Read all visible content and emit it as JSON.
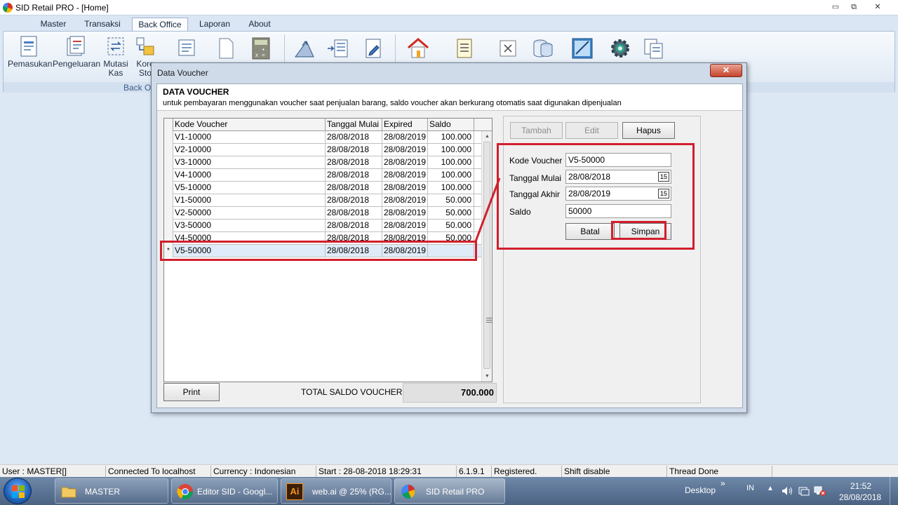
{
  "app": {
    "title": "SID Retail PRO - [Home]",
    "window_controls": {
      "minimize": "▭",
      "restore": "⧉",
      "close": "✕"
    }
  },
  "menu": {
    "tabs": [
      {
        "label": "Master"
      },
      {
        "label": "Transaksi"
      },
      {
        "label": "Back Office",
        "active": true
      },
      {
        "label": "Laporan"
      },
      {
        "label": "About"
      }
    ]
  },
  "ribbon": {
    "buttons": [
      {
        "label": "Pemasukan",
        "icon": "income-document-icon"
      },
      {
        "label": "Pengeluaran",
        "icon": "expense-document-icon"
      },
      {
        "label": "Mutasi",
        "label2": "Kas",
        "icon": "cash-transfer-icon"
      },
      {
        "label": "Kore",
        "label2": "Sto",
        "icon": "stock-correction-icon"
      }
    ],
    "group_label": "Back Off"
  },
  "dialog": {
    "title": "Data Voucher",
    "close_label": "✕",
    "header_title": "DATA VOUCHER",
    "header_subtitle": "untuk pembayaran menggunakan voucher saat penjualan barang, saldo voucher akan berkurang otomatis saat digunakan dipenjualan",
    "grid": {
      "columns": [
        "Kode Voucher",
        "Tanggal Mulai",
        "Expired",
        "Saldo"
      ],
      "rows": [
        [
          "V1-10000",
          "28/08/2018",
          "28/08/2019",
          "100.000"
        ],
        [
          "V2-10000",
          "28/08/2018",
          "28/08/2019",
          "100.000"
        ],
        [
          "V3-10000",
          "28/08/2018",
          "28/08/2019",
          "100.000"
        ],
        [
          "V4-10000",
          "28/08/2018",
          "28/08/2019",
          "100.000"
        ],
        [
          "V5-10000",
          "28/08/2018",
          "28/08/2019",
          "100.000"
        ],
        [
          "V1-50000",
          "28/08/2018",
          "28/08/2019",
          "50.000"
        ],
        [
          "V2-50000",
          "28/08/2018",
          "28/08/2019",
          "50.000"
        ],
        [
          "V3-50000",
          "28/08/2018",
          "28/08/2019",
          "50.000"
        ],
        [
          "V4-50000",
          "28/08/2018",
          "28/08/2019",
          "50.000"
        ]
      ],
      "new_row": {
        "indicator": "*",
        "cells": [
          "V5-50000",
          "28/08/2018",
          "28/08/2019",
          ""
        ]
      }
    },
    "print_label": "Print",
    "total_label": "TOTAL SALDO VOUCHER :",
    "total_value": "700.000",
    "actions": {
      "tambah": "Tambah",
      "edit": "Edit",
      "hapus": "Hapus"
    },
    "form": {
      "kode_label": "Kode Voucher",
      "kode_value": "V5-50000",
      "mulai_label": "Tanggal Mulai",
      "mulai_value": "28/08/2018",
      "akhir_label": "Tanggal Akhir",
      "akhir_value": "28/08/2019",
      "saldo_label": "Saldo",
      "saldo_value": "50000",
      "calendar_glyph": "15",
      "batal_label": "Batal",
      "simpan_label": "Simpan"
    }
  },
  "status": {
    "user": "User : MASTER[]",
    "connection": "Connected To localhost",
    "currency": "Currency : Indonesian",
    "start": "Start  : 28-08-2018 18:29:31",
    "version": "6.1.9.1",
    "registration": "Registered.",
    "shift": "Shift disable",
    "thread": "Thread Done"
  },
  "taskbar": {
    "items": [
      {
        "label": "MASTER",
        "icon": "folder-icon"
      },
      {
        "label": "Editor SID - Googl...",
        "icon": "chrome-icon"
      },
      {
        "label": "web.ai @ 25% (RG...",
        "icon": "illustrator-icon",
        "icon_text": "Ai"
      },
      {
        "label": "SID Retail PRO",
        "icon": "sid-retail-icon"
      }
    ],
    "desktop_label": "Desktop",
    "chevron": "»",
    "language": "IN",
    "time": "21:52",
    "date": "28/08/2018"
  },
  "colors": {
    "annotation": "#d11f2c",
    "accent": "#1d5fb8"
  }
}
